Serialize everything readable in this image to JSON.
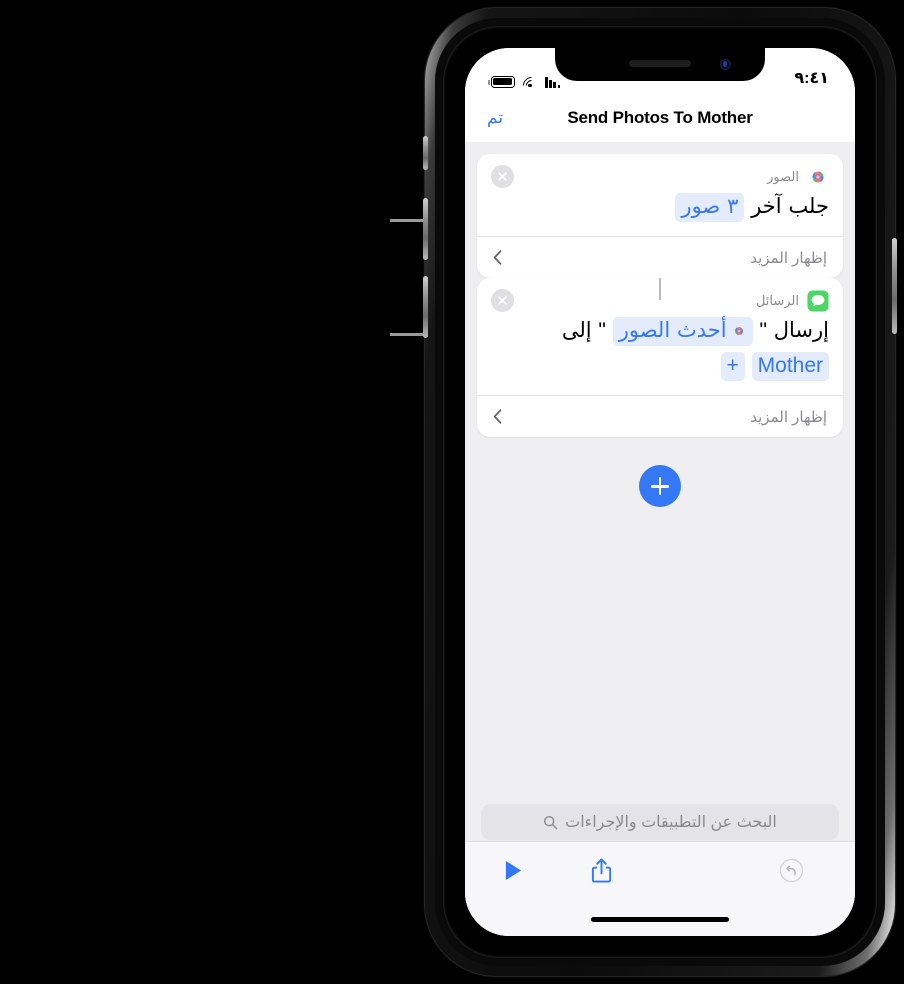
{
  "status_bar": {
    "time": "٩:٤١",
    "icons": [
      "battery-icon",
      "wifi-icon",
      "cellular-signal-icon"
    ]
  },
  "nav_bar": {
    "title": "Send Photos To Mother",
    "done_label": "تم"
  },
  "actions": [
    {
      "app_name": "الصور",
      "app_icon": "photos-icon",
      "text_before": "جلب آخر",
      "token": "٣ صور",
      "show_more_label": "إظهار المزيد",
      "close_icon": "close-icon",
      "chevron_icon": "chevron-left-icon"
    },
    {
      "app_name": "الرسائل",
      "app_icon": "messages-icon",
      "text_before": "إرسال \"",
      "token_icon": "photos-icon",
      "token": "أحدث الصور",
      "text_after": "\" إلى",
      "recipient": "Mother",
      "add_recipient_label": "+",
      "show_more_label": "إظهار المزيد",
      "close_icon": "close-icon",
      "chevron_icon": "chevron-left-icon"
    }
  ],
  "add_action": {
    "label": "+",
    "icon": "plus-icon"
  },
  "search": {
    "placeholder": "البحث عن التطبيقات والإجراءات",
    "icon": "search-icon"
  },
  "toolbar": {
    "play": "play-icon",
    "share": "share-icon",
    "undo": "undo-icon",
    "redo": "redo-icon"
  },
  "colors": {
    "accent": "#3478f6",
    "token_bg": "#e4ecfb",
    "background": "#efeff2",
    "card": "#ffffff",
    "secondary_text": "#8a8a8e",
    "messages_green": "#4cd663"
  }
}
